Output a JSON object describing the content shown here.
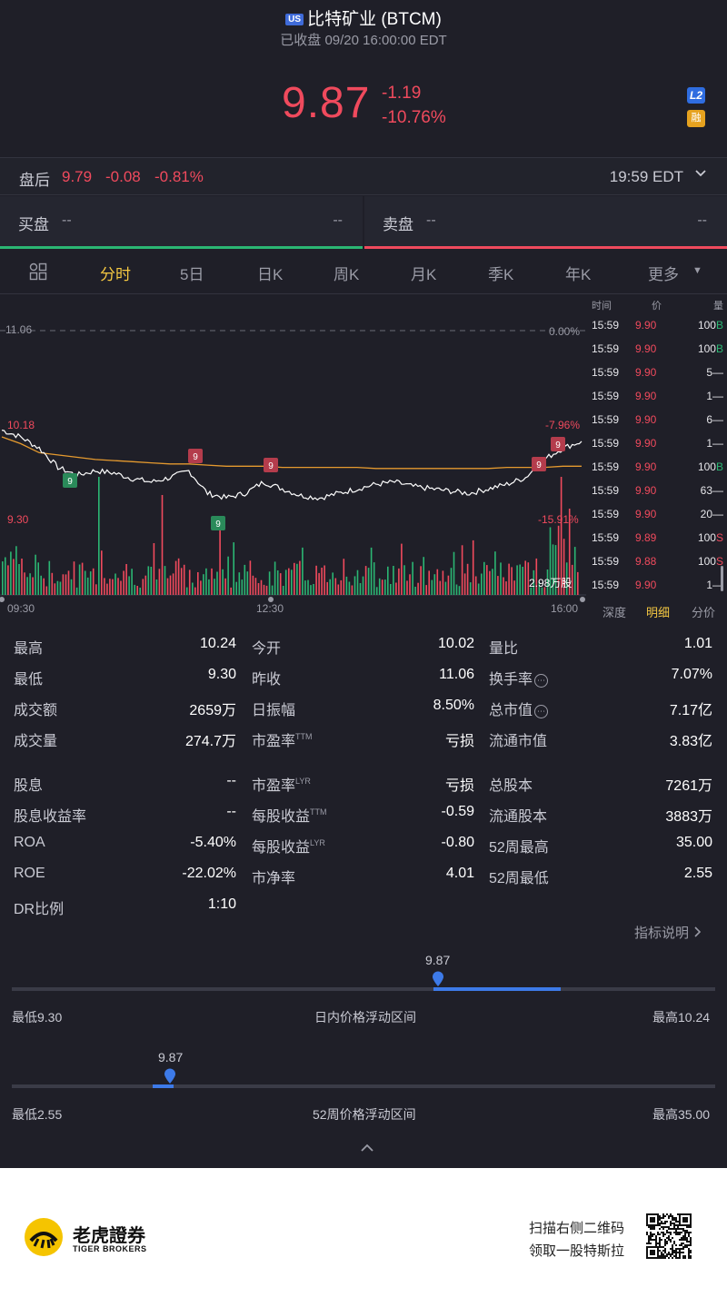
{
  "header": {
    "market_badge": "US",
    "title": "比特矿业 (BTCM)",
    "status": "已收盘 09/20 16:00:00 EDT",
    "price": "9.87",
    "change": "-1.19",
    "change_pct": "-10.76%",
    "l2_badge": "L2",
    "margin_badge": "融"
  },
  "after_hours": {
    "label": "盘后",
    "price": "9.79",
    "change": "-0.08",
    "change_pct": "-0.81%",
    "time": "19:59 EDT"
  },
  "bid_ask": {
    "bid_label": "买盘",
    "bid_price": "--",
    "bid_size": "--",
    "ask_label": "卖盘",
    "ask_price": "--",
    "ask_size": "--"
  },
  "tabs": [
    "分时",
    "5日",
    "日K",
    "周K",
    "月K",
    "季K",
    "年K",
    "更多"
  ],
  "active_tab": "分时",
  "chart": {
    "prev_close_label": "11.06",
    "prev_close_pct": "0.00%",
    "high_label": "10.18",
    "high_pct": "-7.96%",
    "low_label": "9.30",
    "low_pct": "-15.91%",
    "volume_label": "2.98万股",
    "x_ticks": [
      "09:30",
      "12:30",
      "16:00"
    ],
    "signal_marker": "9"
  },
  "chart_data": {
    "type": "line",
    "title": "",
    "xlabel": "",
    "ylabel": "",
    "x_ticks": [
      "09:30",
      "12:30",
      "16:00"
    ],
    "ylim": [
      9.3,
      11.06
    ],
    "reference_price": 11.06,
    "series": [
      {
        "values": [
          10.18,
          10.12,
          10.02,
          9.85,
          9.78,
          9.82,
          9.8,
          9.75,
          9.72,
          9.76,
          9.82,
          9.62,
          9.58,
          9.62,
          9.72,
          9.66,
          9.6,
          9.58,
          9.62,
          9.66,
          9.7,
          9.72,
          9.68,
          9.66,
          9.64,
          9.62,
          9.66,
          9.7,
          9.76,
          9.92,
          10.02,
          10.08
        ]
      },
      {
        "values": [
          10.12,
          10.06,
          9.98,
          9.96,
          9.94,
          9.92,
          9.91,
          9.9,
          9.89,
          9.88,
          9.88,
          9.87,
          9.86,
          9.86,
          9.86,
          9.85,
          9.85,
          9.85,
          9.85,
          9.85,
          9.84,
          9.84,
          9.84,
          9.84,
          9.84,
          9.84,
          9.84,
          9.85,
          9.85,
          9.85,
          9.86,
          9.86
        ]
      }
    ]
  },
  "trades": {
    "headers": [
      "时间",
      "价",
      "量"
    ],
    "rows": [
      {
        "time": "15:59",
        "price": "9.90",
        "qty": "100",
        "side": "B"
      },
      {
        "time": "15:59",
        "price": "9.90",
        "qty": "100",
        "side": "B"
      },
      {
        "time": "15:59",
        "price": "9.90",
        "qty": "5",
        "side": "—"
      },
      {
        "time": "15:59",
        "price": "9.90",
        "qty": "1",
        "side": "—"
      },
      {
        "time": "15:59",
        "price": "9.90",
        "qty": "6",
        "side": "—"
      },
      {
        "time": "15:59",
        "price": "9.90",
        "qty": "1",
        "side": "—"
      },
      {
        "time": "15:59",
        "price": "9.90",
        "qty": "100",
        "side": "B"
      },
      {
        "time": "15:59",
        "price": "9.90",
        "qty": "63",
        "side": "—"
      },
      {
        "time": "15:59",
        "price": "9.90",
        "qty": "20",
        "side": "—"
      },
      {
        "time": "15:59",
        "price": "9.89",
        "qty": "100",
        "side": "S"
      },
      {
        "time": "15:59",
        "price": "9.88",
        "qty": "100",
        "side": "S"
      },
      {
        "time": "15:59",
        "price": "9.90",
        "qty": "1",
        "side": "—"
      }
    ],
    "footer_tabs": [
      "深度",
      "明细",
      "分价"
    ],
    "active_footer": "明细"
  },
  "stats": {
    "col1": [
      {
        "label": "最高",
        "value": "10.24"
      },
      {
        "label": "最低",
        "value": "9.30"
      },
      {
        "label": "成交额",
        "value": "2659万"
      },
      {
        "label": "成交量",
        "value": "274.7万"
      },
      {
        "label": "股息",
        "value": "--"
      },
      {
        "label": "股息收益率",
        "value": "--"
      },
      {
        "label": "ROA",
        "value": "-5.40%"
      },
      {
        "label": "ROE",
        "value": "-22.02%"
      },
      {
        "label": "DR比例",
        "value": "1:10"
      }
    ],
    "col2": [
      {
        "label": "今开",
        "value": "10.02"
      },
      {
        "label": "昨收",
        "value": "11.06"
      },
      {
        "label": "日振幅",
        "value": "8.50%"
      },
      {
        "label": "市盈率",
        "sup": "TTM",
        "value": "亏损"
      },
      {
        "label": "市盈率",
        "sup": "LYR",
        "value": "亏损"
      },
      {
        "label": "每股收益",
        "sup": "TTM",
        "value": "-0.59"
      },
      {
        "label": "每股收益",
        "sup": "LYR",
        "value": "-0.80"
      },
      {
        "label": "市净率",
        "value": "4.01"
      }
    ],
    "col3": [
      {
        "label": "量比",
        "value": "1.01"
      },
      {
        "label": "换手率",
        "value": "7.07%"
      },
      {
        "label": "总市值",
        "value": "7.17亿"
      },
      {
        "label": "流通市值",
        "value": "3.83亿"
      },
      {
        "label": "总股本",
        "value": "7261万"
      },
      {
        "label": "流通股本",
        "value": "3883万"
      },
      {
        "label": "52周最高",
        "value": "35.00"
      },
      {
        "label": "52周最低",
        "value": "2.55"
      }
    ],
    "explain_link": "指标说明"
  },
  "ranges": {
    "day": {
      "current": "9.87",
      "low_label": "最低9.30",
      "title": "日内价格浮动区间",
      "high_label": "最高10.24",
      "fill_start_pct": 0.6,
      "fill_end_pct": 0.78
    },
    "week52": {
      "current": "9.87",
      "low_label": "最低2.55",
      "title": "52周价格浮动区间",
      "high_label": "最高35.00",
      "fill_start_pct": 0.2,
      "fill_end_pct": 0.23
    }
  },
  "footer": {
    "brand_cn": "老虎證券",
    "brand_en": "TIGER BROKERS",
    "promo_line1": "扫描右侧二维码",
    "promo_line2": "领取一股特斯拉"
  },
  "colors": {
    "up": "#2bb673",
    "down": "#f04a5d",
    "accent": "#f5c842",
    "bg": "#1f1f28"
  }
}
